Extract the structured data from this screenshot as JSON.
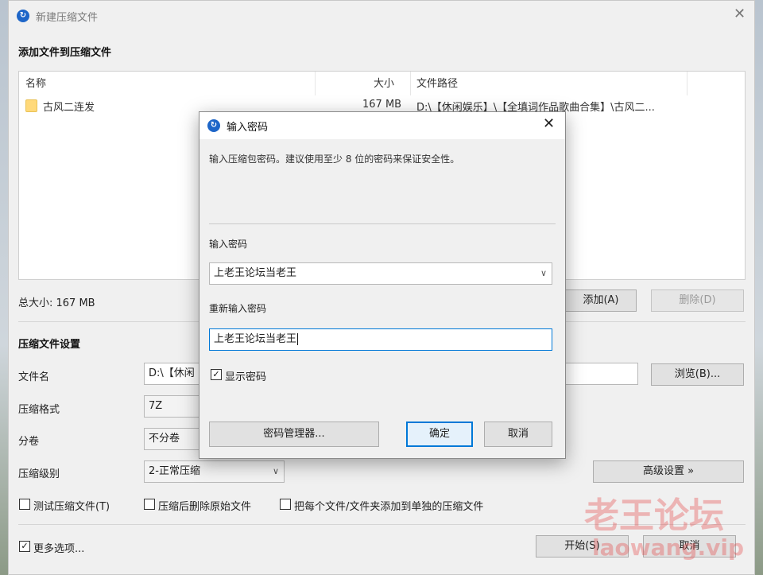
{
  "main_window": {
    "title": "新建压缩文件",
    "add_files_header": "添加文件到压缩文件",
    "columns": {
      "name": "名称",
      "size": "大小",
      "path": "文件路径"
    },
    "files": [
      {
        "name": "古风二连发",
        "size": "167 MB",
        "path": "D:\\【休闲娱乐】\\【全填词作品歌曲合集】\\古风二..."
      }
    ],
    "total_size": "总大小: 167 MB",
    "add_button": "添加(A)",
    "delete_button": "删除(D)",
    "settings_header": "压缩文件设置",
    "filename_label": "文件名",
    "filename_value": "D:\\【休闲",
    "browse_button": "浏览(B)...",
    "format_label": "压缩格式",
    "format_value": "7Z",
    "split_label": "分卷",
    "split_value": "不分卷",
    "level_label": "压缩级别",
    "level_value": "2-正常压缩",
    "advanced_button": "高级设置 »",
    "opt_test": "测试压缩文件(T)",
    "opt_delete_after": "压缩后删除原始文件",
    "opt_separate": "把每个文件/文件夹添加到单独的压缩文件",
    "more_options": "更多选项...",
    "start_button": "开始(S)",
    "cancel_button": "取消"
  },
  "dialog": {
    "title": "输入密码",
    "description": "输入压缩包密码。建议使用至少 8 位的密码来保证安全性。",
    "password_label": "输入密码",
    "password_value": "上老王论坛当老王",
    "reenter_label": "重新输入密码",
    "reenter_value": "上老王论坛当老王",
    "show_password": "显示密码",
    "show_password_checked": true,
    "manager_button": "密码管理器...",
    "ok_button": "确定",
    "cancel_button": "取消"
  },
  "watermark": {
    "line1": "老王论坛",
    "line2": "laowang.vip"
  },
  "colors": {
    "accent": "#1e66c8",
    "focus_border": "#0078d7",
    "watermark": "#e64646"
  }
}
